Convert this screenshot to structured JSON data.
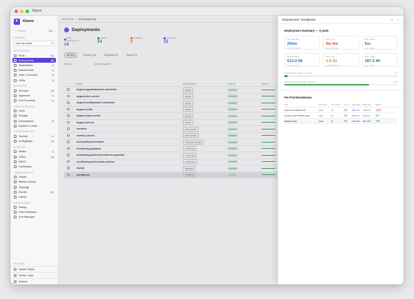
{
  "window": {
    "title": "Kterm"
  },
  "brand": {
    "name": "Kterm",
    "logo": "K"
  },
  "search": {
    "placeholder": "Search",
    "shortcut": "⌘K"
  },
  "context": {
    "label": "CONTEXT",
    "value": "kind-my-cluster"
  },
  "sidebar": {
    "sections": [
      {
        "label": "WORKLOADS",
        "items": [
          {
            "label": "Pods",
            "count": "40",
            "icon": "cube-icon"
          },
          {
            "label": "Deployments",
            "count": "15",
            "icon": "layers-icon",
            "active": true
          },
          {
            "label": "StatefulSets",
            "count": "0",
            "icon": "database-icon"
          },
          {
            "label": "DaemonSets",
            "count": "2",
            "icon": "grid-icon"
          },
          {
            "label": "Jobs / CronJobs",
            "count": "0",
            "icon": "clock-icon"
          },
          {
            "label": "HPAs",
            "count": "0",
            "icon": "scale-icon"
          }
        ]
      },
      {
        "label": "NETWORK",
        "items": [
          {
            "label": "Services",
            "count": "16",
            "icon": "globe-icon"
          },
          {
            "label": "Ingresses",
            "count": "0",
            "icon": "route-icon"
          },
          {
            "label": "Port Forwards",
            "count": "0",
            "icon": "plug-icon"
          }
        ]
      },
      {
        "label": "CONFIGURATION",
        "items": [
          {
            "label": "Helm",
            "count": "",
            "icon": "helm-icon"
          },
          {
            "label": "Storage",
            "count": "",
            "icon": "disk-icon"
          },
          {
            "label": "Namespaces",
            "count": "8",
            "icon": "folder-icon"
          },
          {
            "label": "Quotas & Limits",
            "count": "",
            "icon": "gauge-icon"
          }
        ]
      },
      {
        "label": "CONFIGURATION",
        "items": [
          {
            "label": "Secrets",
            "count": "3",
            "icon": "lock-icon"
          },
          {
            "label": "ConfigMaps",
            "count": "11",
            "icon": "file-icon"
          }
        ]
      },
      {
        "label": "CLUSTER",
        "items": [
          {
            "label": "Nodes",
            "count": "1",
            "icon": "server-icon"
          },
          {
            "label": "CRDs",
            "count": "68",
            "icon": "puzzle-icon"
          },
          {
            "label": "RBAC",
            "count": "",
            "icon": "shield-icon"
          },
          {
            "label": "Certificates",
            "count": "",
            "icon": "certificate-icon"
          }
        ]
      },
      {
        "label": "OBSERVABILITY",
        "items": [
          {
            "label": "Health",
            "count": "",
            "icon": "heart-icon"
          },
          {
            "label": "Metrics History",
            "count": "",
            "icon": "chart-icon"
          },
          {
            "label": "Topology",
            "count": "",
            "icon": "topology-icon"
          },
          {
            "label": "Events",
            "count": "80",
            "icon": "bell-icon"
          },
          {
            "label": "Labels",
            "count": "",
            "icon": "tag-icon"
          }
        ]
      },
      {
        "label": "OPERATIONS",
        "items": [
          {
            "label": "Debug",
            "count": "",
            "icon": "bug-icon"
          },
          {
            "label": "Helm Releases",
            "count": "",
            "icon": "package-icon"
          },
          {
            "label": "Port Manager",
            "count": "",
            "icon": "terminal-icon"
          }
        ]
      }
    ],
    "bottom_section": "PLUGINS",
    "bottom": [
      {
        "label": "Cluster Shape",
        "icon": "shape-icon"
      },
      {
        "label": "Theme: Light",
        "icon": "sun-icon"
      },
      {
        "label": "Refresh",
        "icon": "refresh-icon"
      }
    ]
  },
  "breadcrumb": {
    "root": "Workloads",
    "current": "All deployments"
  },
  "page": {
    "title": "Deployments"
  },
  "stats": [
    {
      "label": "Total Deployments",
      "value": "14",
      "color": "#3a66d0"
    },
    {
      "label": "Healthy",
      "value": "14",
      "color": "#2e8a3e"
    },
    {
      "label": "Degraded",
      "value": "0",
      "color": "#e0781a"
    },
    {
      "label": "Total Pods",
      "value": "15",
      "color": "#5b3fd6"
    }
  ],
  "filters": [
    {
      "label": "All (14)",
      "on": true
    },
    {
      "label": "Healthy (14)",
      "on": false
    },
    {
      "label": "Degraded (0)",
      "on": false
    },
    {
      "label": "Scaled (0)",
      "on": false
    }
  ],
  "toolbar": {
    "filter": "Search...",
    "sort": "All namespaces"
  },
  "table": {
    "columns": [
      "NAME",
      "NAMESPACE",
      "STATUS",
      "READY"
    ],
    "rows": [
      {
        "name": "argocd-applicationset-controller",
        "ns": "argocd",
        "status": "Available"
      },
      {
        "name": "argocd-dex-server",
        "ns": "argocd",
        "status": "Available"
      },
      {
        "name": "argocd-notifications-controller",
        "ns": "argocd",
        "status": "Available"
      },
      {
        "name": "argocd-redis",
        "ns": "argocd",
        "status": "Available"
      },
      {
        "name": "argocd-repo-server",
        "ns": "argocd",
        "status": "Available"
      },
      {
        "name": "argocd-server",
        "ns": "argocd",
        "status": "Available"
      },
      {
        "name": "coredns",
        "ns": "kube-system",
        "status": "Available"
      },
      {
        "name": "metrics-server",
        "ns": "kube-system",
        "status": "Available"
      },
      {
        "name": "local-path-provisioner",
        "ns": "local-path-storage",
        "status": "Available"
      },
      {
        "name": "monitoring-grafana",
        "ns": "monitoring",
        "status": "Available"
      },
      {
        "name": "monitoring-kube-prometheus-operator",
        "ns": "monitoring",
        "status": "Available"
      },
      {
        "name": "monitoring-kube-state-metrics",
        "ns": "monitoring",
        "status": "Available"
      },
      {
        "name": "mysql",
        "ns": "database",
        "status": "Available"
      },
      {
        "name": "wordpress",
        "ns": "wordpress",
        "status": "Available",
        "selected": true
      }
    ]
  },
  "panel": {
    "title": "Deployment: wordpress",
    "summary_title": "Deployment Summary — 2 pods",
    "cards": [
      {
        "label": "CPU Request",
        "value": "200m",
        "sub": "sum of all pods",
        "color": "#3a66d0"
      },
      {
        "label": "CPU Limit",
        "value": "No lim",
        "sub": "not configured",
        "color": "#d83a3a"
      },
      {
        "label": "CPU Usage",
        "value": "5m",
        "sub": "avg. across",
        "color": "#2e8a3e"
      },
      {
        "label": "Mem Request",
        "value": "513.0 Mi",
        "sub": "sum of all pods",
        "color": "#3a66d0"
      },
      {
        "label": "Mem Limit",
        "value": "1.0 Gi",
        "sub": "at 50% headroom",
        "color": "#e0781a"
      },
      {
        "label": "Mem Usage",
        "value": "387.5 Mi",
        "sub": "avg. across",
        "color": "#2e8a3e"
      }
    ],
    "progress": [
      {
        "label": "CPU utilization (usage / request)",
        "value": "3%",
        "fill": 0.03
      },
      {
        "label": "Memory utilization (usage / request)",
        "value": "75%",
        "fill": 0.75
      }
    ],
    "breakdown_title": "Per-Pod Breakdown",
    "breakdown_columns": [
      "POD",
      "CPU REQ",
      "CPU LIMIT",
      "CPU %",
      "MEM REQ",
      "MEM USE",
      "MEM %"
    ],
    "breakdown_rows": [
      {
        "pod": "wpgrp-5fcc4d5b89-7hzdf",
        "cpu_req": "100m",
        "cpu_lim": "No",
        "cpu_pct": "2%",
        "mem_req": "256.5 Mi",
        "mem_use": "270.9 Mi",
        "mem_pct": "106%",
        "mem_pct_bad": true
      },
      {
        "pod": "wordpress-6877b6d5f9-x9kmr",
        "cpu_req": "100m",
        "cpu_lim": "No",
        "cpu_pct": "5%",
        "mem_req": "256.5 Mi",
        "mem_use": "10.8 Mi",
        "mem_pct": "4%"
      },
      {
        "pod": "Total (2 pods)",
        "cpu_req": "200m",
        "cpu_lim": "No",
        "cpu_pct": "3%",
        "mem_req": "513.0 Mi",
        "mem_use": "387.5 Mi",
        "mem_pct": "75%",
        "total": true
      }
    ]
  }
}
